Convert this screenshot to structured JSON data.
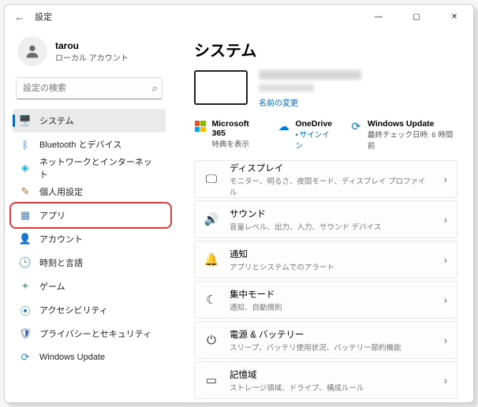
{
  "titlebar": {
    "title": "設定"
  },
  "account": {
    "name": "tarou",
    "subtitle": "ローカル アカウント"
  },
  "search": {
    "placeholder": "設定の検索"
  },
  "nav": [
    {
      "id": "system",
      "label": "システム",
      "icon": "🖥️",
      "color": "#4a7dc9",
      "active": true
    },
    {
      "id": "bluetooth",
      "label": "Bluetooth とデバイス",
      "icon": "ᛒ",
      "color": "#1a6fd6"
    },
    {
      "id": "network",
      "label": "ネットワークとインターネット",
      "icon": "◈",
      "color": "#15b1d6"
    },
    {
      "id": "personalization",
      "label": "個人用設定",
      "icon": "✎",
      "color": "#c06a2e"
    },
    {
      "id": "apps",
      "label": "アプリ",
      "icon": "▦",
      "color": "#5b7fa6",
      "highlight": true
    },
    {
      "id": "accounts",
      "label": "アカウント",
      "icon": "👤",
      "color": "#d18a3a"
    },
    {
      "id": "time",
      "label": "時刻と言語",
      "icon": "🕒",
      "color": "#4a6"
    },
    {
      "id": "gaming",
      "label": "ゲーム",
      "icon": "✦",
      "color": "#7aa"
    },
    {
      "id": "accessibility",
      "label": "アクセシビリティ",
      "icon": "⦿",
      "color": "#2a7fc9"
    },
    {
      "id": "privacy",
      "label": "プライバシーとセキュリティ",
      "icon": "🛡",
      "color": "#3a5fa0"
    },
    {
      "id": "update",
      "label": "Windows Update",
      "icon": "⟳",
      "color": "#1e8fd6"
    }
  ],
  "page": {
    "title": "システム",
    "rename": "名前の変更",
    "services": {
      "m365": {
        "title": "Microsoft 365",
        "subtitle": "特典を表示"
      },
      "onedrive": {
        "title": "OneDrive",
        "subtitle": "サインイン"
      },
      "update": {
        "title": "Windows Update",
        "subtitle": "最終チェック日時: 6 時間前"
      }
    },
    "cards": [
      {
        "id": "display",
        "icon": "🖵",
        "title": "ディスプレイ",
        "subtitle": "モニター、明るさ、夜間モード、ディスプレイ プロファイル"
      },
      {
        "id": "sound",
        "icon": "🔊",
        "title": "サウンド",
        "subtitle": "音量レベル、出力、入力、サウンド デバイス"
      },
      {
        "id": "notifications",
        "icon": "🔔",
        "title": "通知",
        "subtitle": "アプリとシステムでのアラート"
      },
      {
        "id": "focus",
        "icon": "☾",
        "title": "集中モード",
        "subtitle": "通知、自動規則"
      },
      {
        "id": "power",
        "icon": "⏻",
        "title": "電源 & バッテリー",
        "subtitle": "スリープ、バッテリ使用状況、バッテリー節約機能"
      },
      {
        "id": "storage",
        "icon": "▭",
        "title": "記憶域",
        "subtitle": "ストレージ領域、ドライブ、構成ルール"
      }
    ]
  }
}
